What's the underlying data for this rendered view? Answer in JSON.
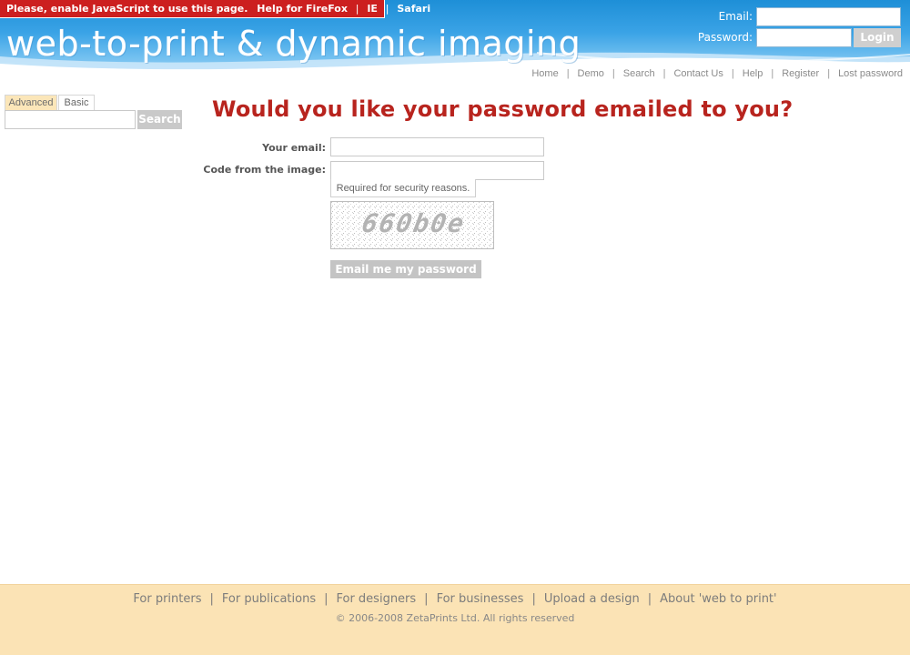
{
  "js_banner": {
    "message": "Please, enable JavaScript to use this page.",
    "help_label": "Help for FireFox",
    "ie_label": "IE",
    "safari_label": "Safari",
    "separator": "|"
  },
  "header": {
    "site_title": "web-to-print & dynamic imaging",
    "login": {
      "email_label": "Email:",
      "password_label": "Password:",
      "email_value": "",
      "password_value": "",
      "login_label": "Login"
    },
    "nav": [
      "Home",
      "Demo",
      "Search",
      "Contact Us",
      "Help",
      "Register",
      "Lost password"
    ],
    "nav_separator": "|"
  },
  "search": {
    "tabs": [
      "Advanced",
      "Basic"
    ],
    "active_tab": "Advanced",
    "query": "",
    "button_label": "Search"
  },
  "form": {
    "title": "Would you like your password emailed to you?",
    "email_label": "Your email:",
    "email_value": "",
    "code_label": "Code from the image:",
    "code_value": "",
    "code_hint": "Required for security reasons.",
    "captcha_text": "660b0e",
    "submit_label": "Email me my password"
  },
  "footer": {
    "links": [
      "For printers",
      "For publications",
      "For designers",
      "For businesses",
      "Upload a design",
      "About 'web to print'"
    ],
    "separator": "|",
    "copyright": "© 2006-2008 ZetaPrints Ltd. All rights reserved"
  },
  "colors": {
    "header_blue": "#2a98dd",
    "banner_red": "#cc1f1f",
    "title_red": "#b8241e",
    "footer_bg": "#fbe3b5",
    "button_gray": "#c9c9c9"
  }
}
